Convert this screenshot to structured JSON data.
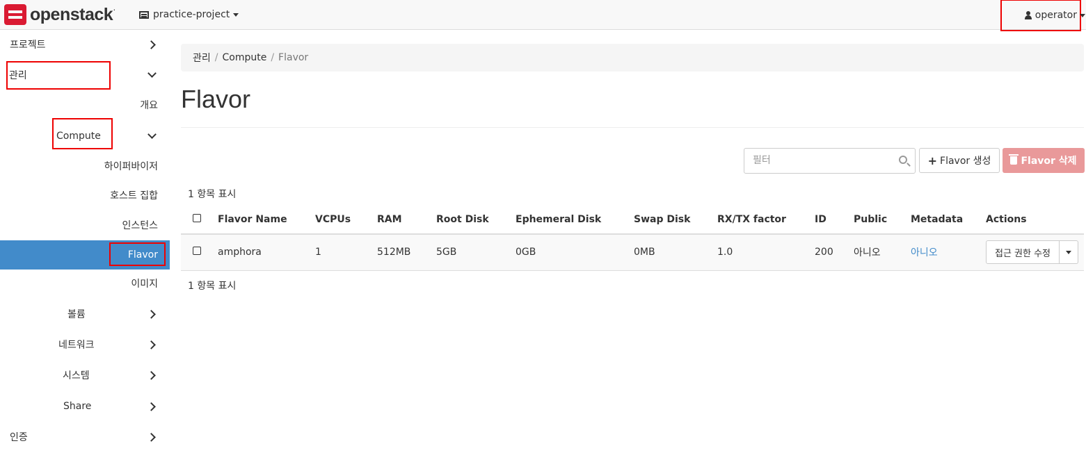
{
  "navbar": {
    "logo_text": "openstack",
    "logo_dot": ".",
    "project": "practice-project",
    "user": "operator"
  },
  "sidebar": {
    "items": [
      {
        "label": "프로젝트"
      },
      {
        "label": "관리"
      },
      {
        "label": "개요"
      },
      {
        "label": "Compute"
      },
      {
        "label": "하이퍼바이저"
      },
      {
        "label": "호스트 집합"
      },
      {
        "label": "인스턴스"
      },
      {
        "label": "Flavor"
      },
      {
        "label": "이미지"
      },
      {
        "label": "볼륨"
      },
      {
        "label": "네트워크"
      },
      {
        "label": "시스템"
      },
      {
        "label": "Share"
      },
      {
        "label": "인증"
      }
    ]
  },
  "breadcrumb": [
    "관리",
    "Compute",
    "Flavor"
  ],
  "breadcrumb_sep": "/",
  "page_title": "Flavor",
  "toolbar": {
    "filter_placeholder": "필터",
    "create_label": "Flavor 생성",
    "delete_label": "Flavor 삭제"
  },
  "count_label": "1 항목 표시",
  "table": {
    "columns": [
      "Flavor Name",
      "VCPUs",
      "RAM",
      "Root Disk",
      "Ephemeral Disk",
      "Swap Disk",
      "RX/TX factor",
      "ID",
      "Public",
      "Metadata",
      "Actions"
    ],
    "rows": [
      {
        "name": "amphora",
        "vcpus": "1",
        "ram": "512MB",
        "root_disk": "5GB",
        "ephemeral_disk": "0GB",
        "swap_disk": "0MB",
        "rxtx": "1.0",
        "id": "200",
        "public": "아니오",
        "metadata": "아니오",
        "action": "접근 권한 수정"
      }
    ]
  },
  "colors": {
    "active_bg": "#428bca",
    "delete_btn": "#e9999a",
    "logo_red": "#da1a32",
    "highlight_box": "#ee0000"
  }
}
